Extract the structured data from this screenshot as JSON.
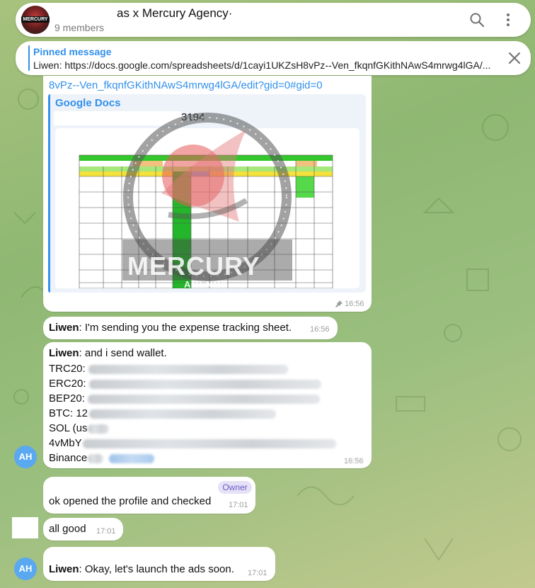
{
  "header": {
    "title": "as x Mercury Agency·",
    "members": "9 members",
    "logo_text": "MERCURY"
  },
  "pinned": {
    "title": "Pinned message",
    "text": "Liwen: https://docs.google.com/spreadsheets/d/1cayi1UKZsH8vPz--Ven_fkqnfGKithNAwS4mrwg4lGA/..."
  },
  "messages": {
    "link_msg": {
      "url_tail": "8vPz--Ven_fkqnfGKithNAwS4mrwg4lGA/edit?gid=0#gid=0",
      "preview_site": "Google Docs",
      "preview_title": "3194",
      "watermark": "MERCURY",
      "watermark_sub": "AGENCY",
      "time": "16:56"
    },
    "expense": {
      "sender": "Liwen",
      "text": ": I'm sending you the expense tracking sheet.",
      "time": "16:56"
    },
    "wallet": {
      "sender": "Liwen",
      "text": ": and i send wallet.",
      "lines": [
        "TRC20:",
        "ERC20:",
        "BEP20:",
        "BTC: 12",
        "SOL (us",
        "4vMbY",
        "Binance"
      ],
      "time": "16:56",
      "avatar": "AH"
    },
    "ok_opened": {
      "badge": "Owner",
      "text": "ok opened the profile and checked",
      "time": "17:01"
    },
    "all_good": {
      "text": "all good",
      "time": "17:01"
    },
    "launch": {
      "sender": "Liwen",
      "text": ": Okay, let's launch the ads soon.",
      "time": "17:01",
      "avatar": "AH"
    }
  },
  "colors": {
    "accent": "#3390ec",
    "avatar": "#5aa8f0",
    "owner_badge": "#6b5fc4"
  }
}
